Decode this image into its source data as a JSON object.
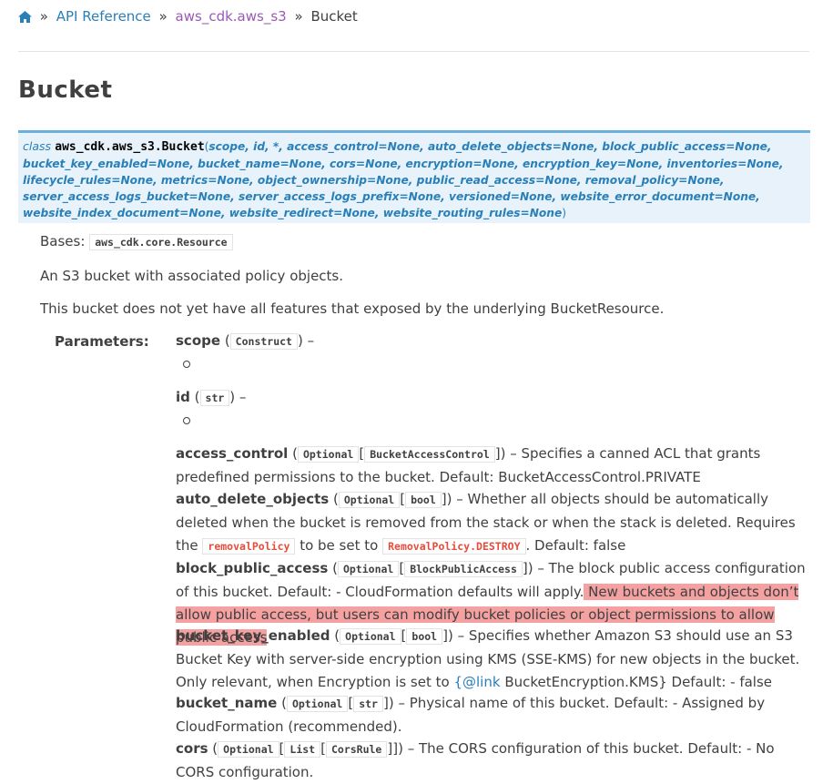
{
  "breadcrumb": {
    "home_icon": "home-icon",
    "separator": "»",
    "items": [
      "API Reference",
      "aws_cdk.aws_s3",
      "Bucket"
    ]
  },
  "title": "Bucket",
  "signature": {
    "keyword": "class",
    "class_name": "aws_cdk.aws_s3.Bucket",
    "open_paren": "(",
    "params": "scope, id, *, access_control=None, auto_delete_objects=None, block_public_access=None, bucket_key_enabled=None, bucket_name=None, cors=None, encryption=None, encryption_key=None, inventories=None, lifecycle_rules=None, metrics=None, object_ownership=None, public_read_access=None, removal_policy=None, server_access_logs_bucket=None, server_access_logs_prefix=None, versioned=None, website_error_document=None, website_index_document=None, website_redirect=None, website_routing_rules=None",
    "close_paren": ")"
  },
  "bases_label": "Bases:",
  "bases_value": "aws_cdk.core.Resource",
  "description_1": "An S3 bucket with associated policy objects.",
  "description_2": "This bucket does not yet have all features that exposed by the underlying BucketResource.",
  "parameters_label": "Parameters:",
  "params": {
    "scope": {
      "name": "scope",
      "type": "Construct",
      "dash": "–"
    },
    "id": {
      "name": "id",
      "type": "str",
      "dash": "–"
    },
    "access_control": {
      "name": "access_control",
      "opt": "Optional",
      "type": "BucketAccessControl",
      "desc": "– Specifies a canned ACL that grants predefined permissions to the bucket. Default: BucketAccessControl.PRIVATE"
    },
    "auto_delete_objects": {
      "name": "auto_delete_objects",
      "opt": "Optional",
      "type": "bool",
      "desc1": "– Whether all objects should be automatically deleted when the bucket is removed from the stack or when the stack is deleted. Requires the",
      "code1": "removalPolicy",
      "mid": "to be set to",
      "code2": "RemovalPolicy.DESTROY",
      "desc2": ". Default: false"
    },
    "block_public_access": {
      "name": "block_public_access",
      "opt": "Optional",
      "type": "BlockPublicAccess",
      "desc": "– The block public access configuration of this bucket. Default: - CloudFormation defaults will apply.",
      "highlight": " New buckets and objects don’t allow public access, but users can modify bucket policies or object permissions to allow public access "
    },
    "bucket_key_enabled": {
      "name": "bucket_key_enabled",
      "opt": "Optional",
      "type": "bool",
      "desc1": "– Specifies whether Amazon S3 should use an S3 Bucket Key with server-side encryption using KMS (SSE-KMS) for new objects in the bucket. Only relevant, when Encryption is set to",
      "link": "{@link",
      "desc2": "BucketEncryption.KMS} Default: - false"
    },
    "bucket_name": {
      "name": "bucket_name",
      "opt": "Optional",
      "type": "str",
      "desc": "– Physical name of this bucket. Default: - Assigned by CloudFormation (recommended)."
    },
    "cors": {
      "name": "cors",
      "opt": "Optional",
      "list": "List",
      "type": "CorsRule",
      "desc": "– The CORS configuration of this bucket. Default: - No CORS configuration."
    }
  },
  "colors": {
    "link": "#2980b9",
    "module_link": "#9b59b6",
    "sig_bg": "#e7f2fa",
    "sig_border": "#6ab0de",
    "highlight": "#f5a1a1"
  }
}
